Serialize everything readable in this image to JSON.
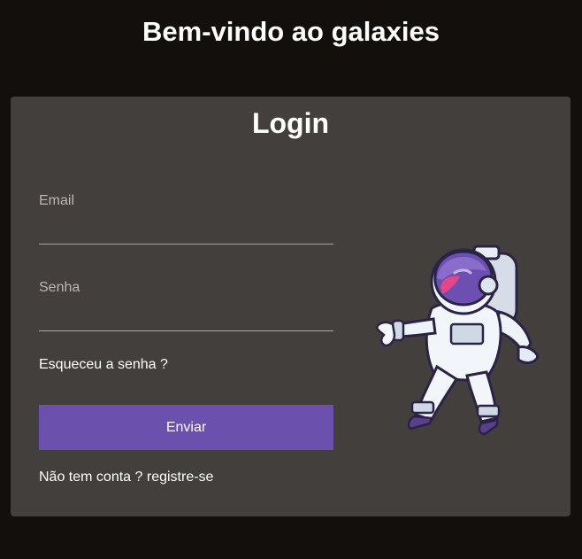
{
  "header": {
    "welcome": "Bem-vindo ao galaxies"
  },
  "login": {
    "title": "Login",
    "email_label": "Email",
    "email_value": "",
    "password_label": "Senha",
    "password_value": "",
    "forgot_label": "Esqueceu a senha ?",
    "submit_label": "Enviar",
    "signup_prefix": "Não tem conta ?",
    "signup_link": "registre-se"
  },
  "illustration": {
    "icon": "astronaut-icon"
  },
  "colors": {
    "background": "#120f0d",
    "card": "#433f3d",
    "accent": "#6b51ad",
    "underline": "#d48fb0"
  }
}
